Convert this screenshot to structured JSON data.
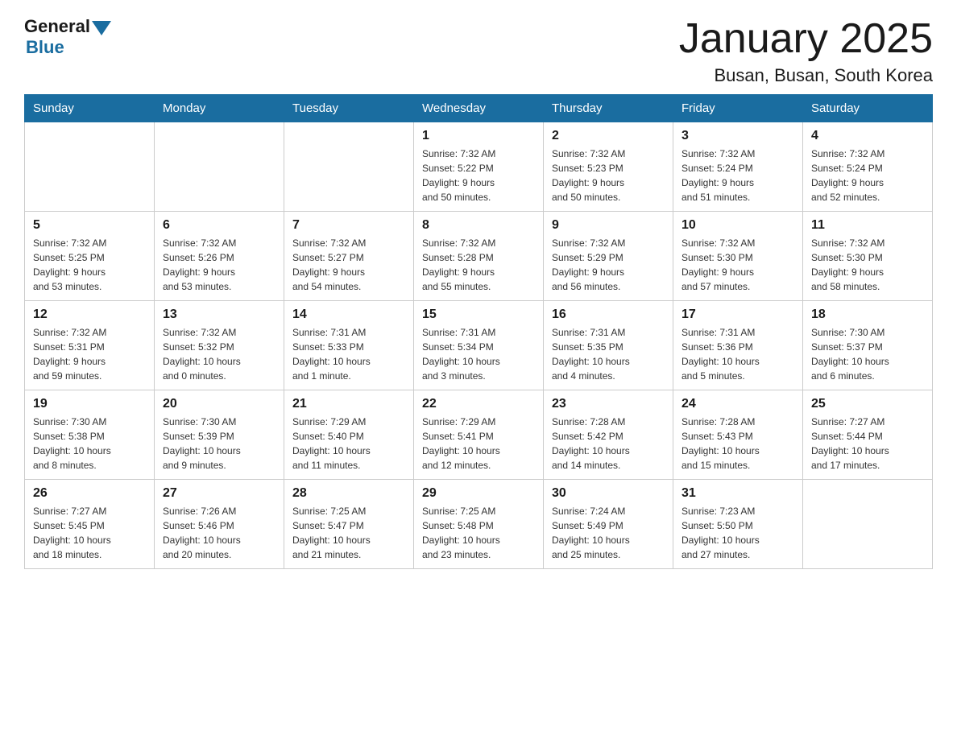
{
  "header": {
    "logo_general": "General",
    "logo_blue": "Blue",
    "title": "January 2025",
    "subtitle": "Busan, Busan, South Korea"
  },
  "days_of_week": [
    "Sunday",
    "Monday",
    "Tuesday",
    "Wednesday",
    "Thursday",
    "Friday",
    "Saturday"
  ],
  "weeks": [
    [
      {
        "day": "",
        "info": ""
      },
      {
        "day": "",
        "info": ""
      },
      {
        "day": "",
        "info": ""
      },
      {
        "day": "1",
        "info": "Sunrise: 7:32 AM\nSunset: 5:22 PM\nDaylight: 9 hours\nand 50 minutes."
      },
      {
        "day": "2",
        "info": "Sunrise: 7:32 AM\nSunset: 5:23 PM\nDaylight: 9 hours\nand 50 minutes."
      },
      {
        "day": "3",
        "info": "Sunrise: 7:32 AM\nSunset: 5:24 PM\nDaylight: 9 hours\nand 51 minutes."
      },
      {
        "day": "4",
        "info": "Sunrise: 7:32 AM\nSunset: 5:24 PM\nDaylight: 9 hours\nand 52 minutes."
      }
    ],
    [
      {
        "day": "5",
        "info": "Sunrise: 7:32 AM\nSunset: 5:25 PM\nDaylight: 9 hours\nand 53 minutes."
      },
      {
        "day": "6",
        "info": "Sunrise: 7:32 AM\nSunset: 5:26 PM\nDaylight: 9 hours\nand 53 minutes."
      },
      {
        "day": "7",
        "info": "Sunrise: 7:32 AM\nSunset: 5:27 PM\nDaylight: 9 hours\nand 54 minutes."
      },
      {
        "day": "8",
        "info": "Sunrise: 7:32 AM\nSunset: 5:28 PM\nDaylight: 9 hours\nand 55 minutes."
      },
      {
        "day": "9",
        "info": "Sunrise: 7:32 AM\nSunset: 5:29 PM\nDaylight: 9 hours\nand 56 minutes."
      },
      {
        "day": "10",
        "info": "Sunrise: 7:32 AM\nSunset: 5:30 PM\nDaylight: 9 hours\nand 57 minutes."
      },
      {
        "day": "11",
        "info": "Sunrise: 7:32 AM\nSunset: 5:30 PM\nDaylight: 9 hours\nand 58 minutes."
      }
    ],
    [
      {
        "day": "12",
        "info": "Sunrise: 7:32 AM\nSunset: 5:31 PM\nDaylight: 9 hours\nand 59 minutes."
      },
      {
        "day": "13",
        "info": "Sunrise: 7:32 AM\nSunset: 5:32 PM\nDaylight: 10 hours\nand 0 minutes."
      },
      {
        "day": "14",
        "info": "Sunrise: 7:31 AM\nSunset: 5:33 PM\nDaylight: 10 hours\nand 1 minute."
      },
      {
        "day": "15",
        "info": "Sunrise: 7:31 AM\nSunset: 5:34 PM\nDaylight: 10 hours\nand 3 minutes."
      },
      {
        "day": "16",
        "info": "Sunrise: 7:31 AM\nSunset: 5:35 PM\nDaylight: 10 hours\nand 4 minutes."
      },
      {
        "day": "17",
        "info": "Sunrise: 7:31 AM\nSunset: 5:36 PM\nDaylight: 10 hours\nand 5 minutes."
      },
      {
        "day": "18",
        "info": "Sunrise: 7:30 AM\nSunset: 5:37 PM\nDaylight: 10 hours\nand 6 minutes."
      }
    ],
    [
      {
        "day": "19",
        "info": "Sunrise: 7:30 AM\nSunset: 5:38 PM\nDaylight: 10 hours\nand 8 minutes."
      },
      {
        "day": "20",
        "info": "Sunrise: 7:30 AM\nSunset: 5:39 PM\nDaylight: 10 hours\nand 9 minutes."
      },
      {
        "day": "21",
        "info": "Sunrise: 7:29 AM\nSunset: 5:40 PM\nDaylight: 10 hours\nand 11 minutes."
      },
      {
        "day": "22",
        "info": "Sunrise: 7:29 AM\nSunset: 5:41 PM\nDaylight: 10 hours\nand 12 minutes."
      },
      {
        "day": "23",
        "info": "Sunrise: 7:28 AM\nSunset: 5:42 PM\nDaylight: 10 hours\nand 14 minutes."
      },
      {
        "day": "24",
        "info": "Sunrise: 7:28 AM\nSunset: 5:43 PM\nDaylight: 10 hours\nand 15 minutes."
      },
      {
        "day": "25",
        "info": "Sunrise: 7:27 AM\nSunset: 5:44 PM\nDaylight: 10 hours\nand 17 minutes."
      }
    ],
    [
      {
        "day": "26",
        "info": "Sunrise: 7:27 AM\nSunset: 5:45 PM\nDaylight: 10 hours\nand 18 minutes."
      },
      {
        "day": "27",
        "info": "Sunrise: 7:26 AM\nSunset: 5:46 PM\nDaylight: 10 hours\nand 20 minutes."
      },
      {
        "day": "28",
        "info": "Sunrise: 7:25 AM\nSunset: 5:47 PM\nDaylight: 10 hours\nand 21 minutes."
      },
      {
        "day": "29",
        "info": "Sunrise: 7:25 AM\nSunset: 5:48 PM\nDaylight: 10 hours\nand 23 minutes."
      },
      {
        "day": "30",
        "info": "Sunrise: 7:24 AM\nSunset: 5:49 PM\nDaylight: 10 hours\nand 25 minutes."
      },
      {
        "day": "31",
        "info": "Sunrise: 7:23 AM\nSunset: 5:50 PM\nDaylight: 10 hours\nand 27 minutes."
      },
      {
        "day": "",
        "info": ""
      }
    ]
  ]
}
